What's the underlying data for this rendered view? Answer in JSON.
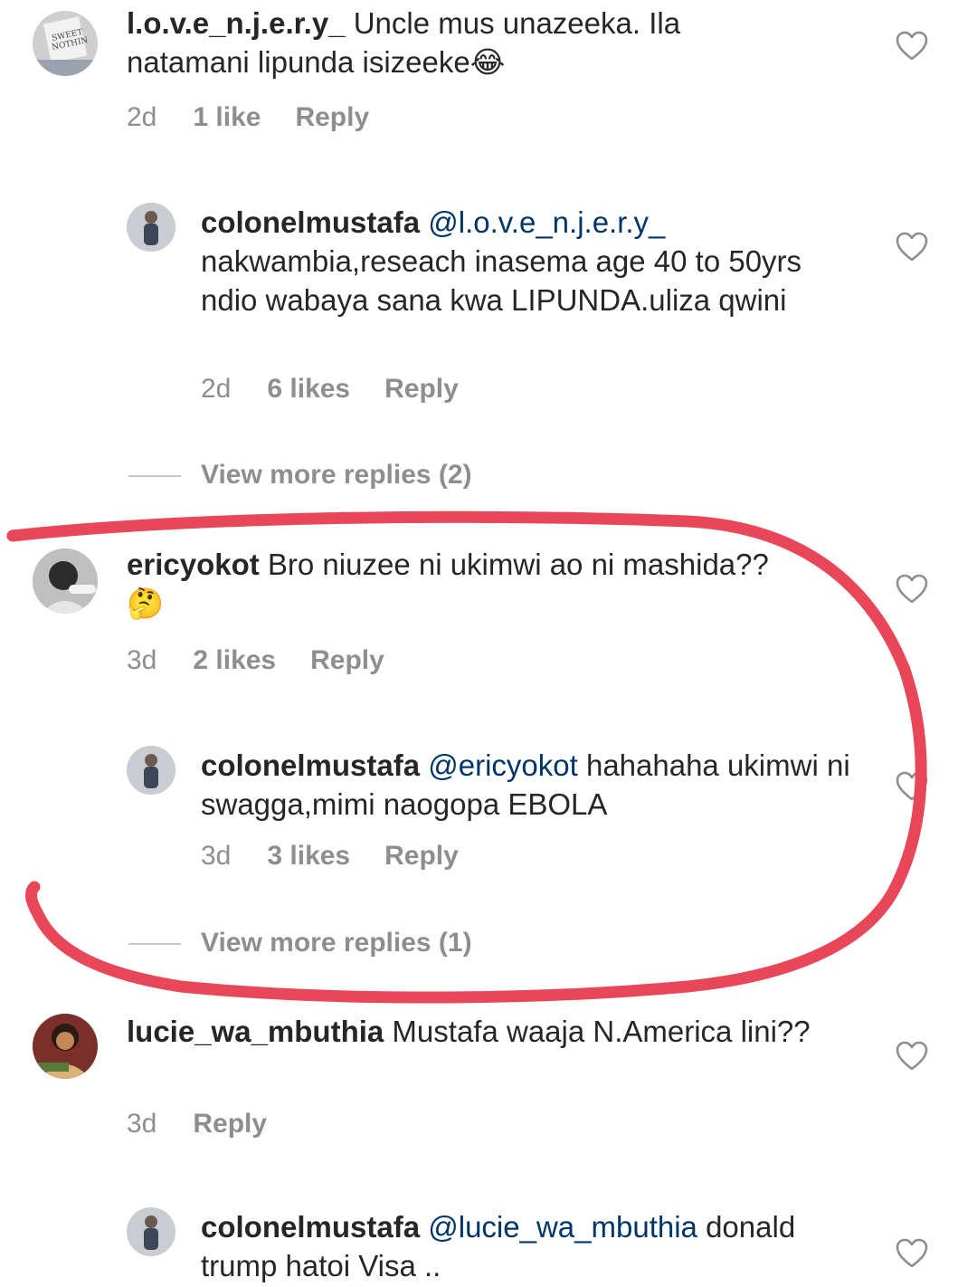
{
  "comments": [
    {
      "username": "l.o.v.e_n.j.e.r.y_",
      "text": " Uncle mus unazeeka. Ila natamani lipunda isizeeke😂",
      "time": "2d",
      "likes": "1 like",
      "reply": "Reply"
    },
    {
      "username": "colonelmustafa",
      "mention": "@l.o.v.e_n.j.e.r.y_",
      "text": " nakwambia,reseach inasema age 40 to 50yrs ndio wabaya sana kwa LIPUNDA.uliza qwini",
      "time": "2d",
      "likes": "6 likes",
      "reply": "Reply"
    },
    {
      "view_more": "View more replies (2)"
    },
    {
      "username": "ericyokot",
      "text": " Bro niuzee ni ukimwi ao ni mashida??🤔",
      "time": "3d",
      "likes": "2 likes",
      "reply": "Reply"
    },
    {
      "username": "colonelmustafa",
      "mention": "@ericyokot",
      "text": " hahahaha ukimwi ni swagga,mimi naogopa EBOLA",
      "time": "3d",
      "likes": "3 likes",
      "reply": "Reply"
    },
    {
      "view_more": "View more replies (1)"
    },
    {
      "username": "lucie_wa_mbuthia",
      "text": " Mustafa waaja N.America lini??",
      "time": "3d",
      "reply": "Reply"
    },
    {
      "username": "colonelmustafa",
      "mention": "@lucie_wa_mbuthia",
      "text": " donald trump hatoi Visa .."
    }
  ],
  "icons": {
    "like": "heart-outline-icon",
    "avatar": "user-avatar"
  },
  "colors": {
    "annotation_stroke": "#e8475a",
    "mention": "#003569",
    "meta": "#8e8e8e"
  }
}
